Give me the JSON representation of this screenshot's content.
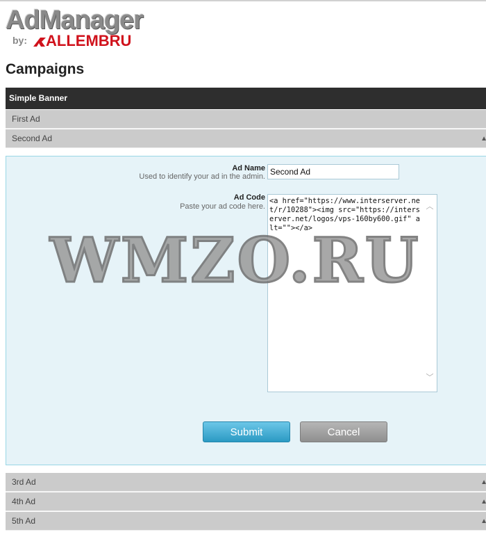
{
  "logo": {
    "name": "AdManager",
    "by": "by:",
    "brand": "ALLEMBRU"
  },
  "page_title": "Campaigns",
  "campaign": {
    "name": "Simple Banner"
  },
  "ads_before": [
    {
      "label": "First Ad"
    },
    {
      "label": "Second Ad"
    }
  ],
  "edit_form": {
    "ad_name_label": "Ad Name",
    "ad_name_hint": "Used to identify your ad in the admin.",
    "ad_name_value": "Second Ad",
    "ad_code_label": "Ad Code",
    "ad_code_hint": "Paste your ad code here.",
    "ad_code_value": "<a href=\"https://www.interserver.net/r/10288\"><img src=\"https://interserver.net/logos/vps-160by600.gif\" alt=\"\"></a>",
    "submit_label": "Submit",
    "cancel_label": "Cancel"
  },
  "ads_after": [
    {
      "label": "3rd Ad"
    },
    {
      "label": "4th Ad"
    },
    {
      "label": "5th Ad"
    }
  ],
  "watermark": "WMZO.RU",
  "colors": {
    "header_bg": "#2e2e2e",
    "row_bg": "#cbcbcb",
    "panel_bg": "#e6f3f8",
    "panel_border": "#98d6e6",
    "submit": "#2b9ac3",
    "cancel": "#8f8f8f",
    "brand_red": "#d0121c"
  }
}
